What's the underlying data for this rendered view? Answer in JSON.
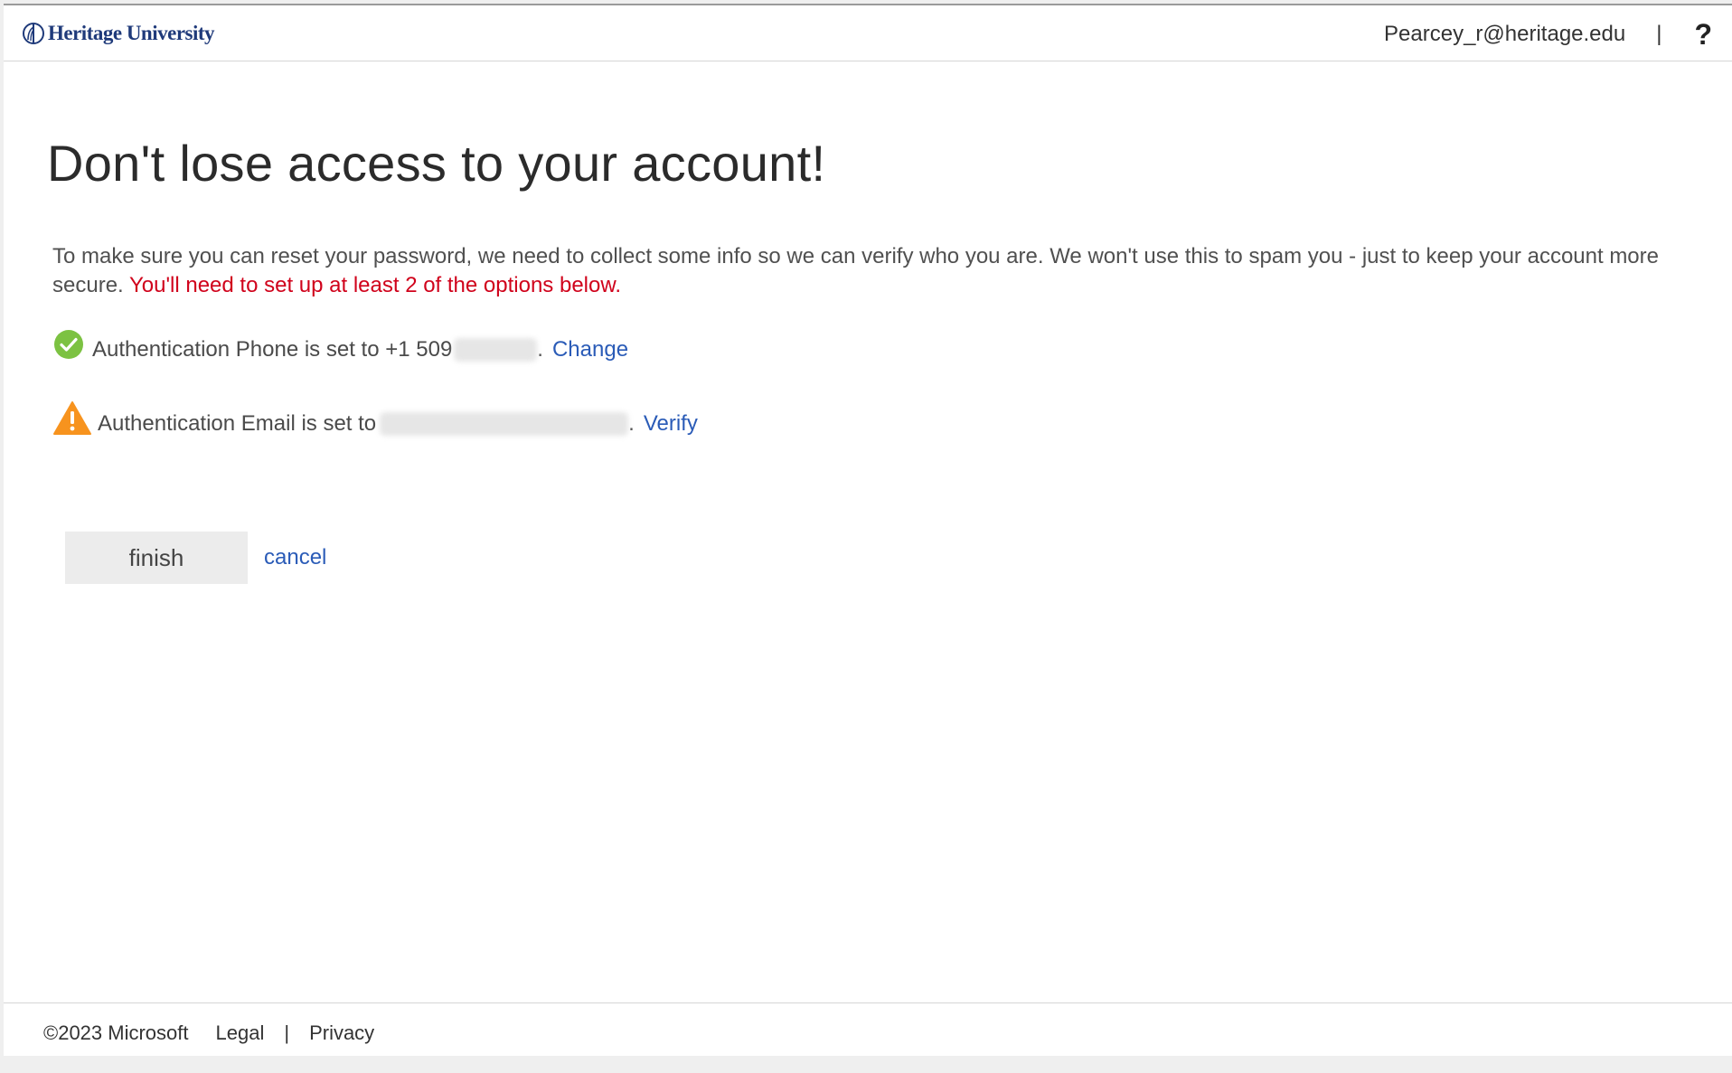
{
  "header": {
    "logo_text": "Heritage University",
    "user_email": "Pearcey_r@heritage.edu",
    "separator": "|",
    "help_label": "?"
  },
  "main": {
    "title": "Don't lose access to your account!",
    "intro": "To make sure you can reset your password, we need to collect some info so we can verify who you are. We won't use this to spam you - just to keep your account more secure.",
    "requirement": "You'll need to set up at least 2 of the options below.",
    "methods": [
      {
        "label": "Authentication Phone is set to +1 509",
        "value_redacted": true,
        "action": "Change",
        "status_icon": "check-circle-icon",
        "status_color": "#7cc242"
      },
      {
        "label": "Authentication Email is set to",
        "value_redacted": true,
        "action": "Verify",
        "status_icon": "warning-triangle-icon",
        "status_color": "#f7931e"
      }
    ],
    "finish_label": "finish",
    "cancel_label": "cancel"
  },
  "footer": {
    "copyright": "©2023 Microsoft",
    "legal": "Legal",
    "separator": "|",
    "privacy": "Privacy"
  },
  "colors": {
    "link": "#2a5bb7",
    "warning_text": "#d0021b",
    "logo": "#1f3a7a"
  }
}
